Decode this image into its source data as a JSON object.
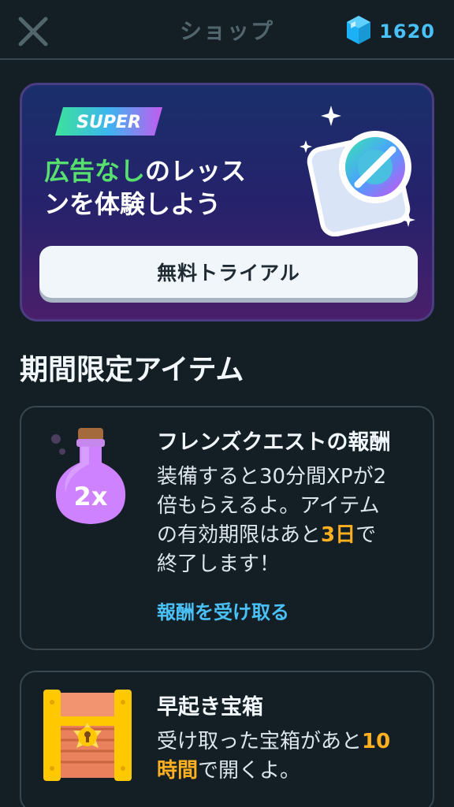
{
  "header": {
    "title": "ショップ",
    "gem_count": "1620"
  },
  "super_card": {
    "badge": "SUPER",
    "headline_highlight": "広告なし",
    "headline_line1_rest": "のレッス",
    "headline_line2": "ンを体験しよう",
    "trial_button": "無料トライアル"
  },
  "section": {
    "title": "期間限定アイテム"
  },
  "items": [
    {
      "title": "フレンズクエストの報酬",
      "icon_label": "2x",
      "desc_line1": "装備すると30分間XPが2",
      "desc_line2": "倍もらえるよ。アイテム",
      "desc_line3_pre": "の有効期限はあと",
      "desc_line3_hl": "3日",
      "desc_line3_post": "で",
      "desc_line4": "終了します！",
      "link": "報酬を受け取る"
    },
    {
      "title": "早起き宝箱",
      "desc_line1_pre": "受け取った宝箱があと",
      "desc_line1_hl": "10",
      "desc_line2_hl": "時間",
      "desc_line2_post": "で開くよ。"
    }
  ],
  "colors": {
    "background": "#131f24",
    "accent_blue": "#49c0f8",
    "highlight_green": "#58e06f",
    "highlight_orange": "#ffb020",
    "border": "#37464f"
  },
  "icons": {
    "close": "close-icon",
    "gem": "gem-icon",
    "potion": "xp-potion-icon",
    "chest": "treasure-chest-icon",
    "no_ads": "no-ads-icon"
  }
}
